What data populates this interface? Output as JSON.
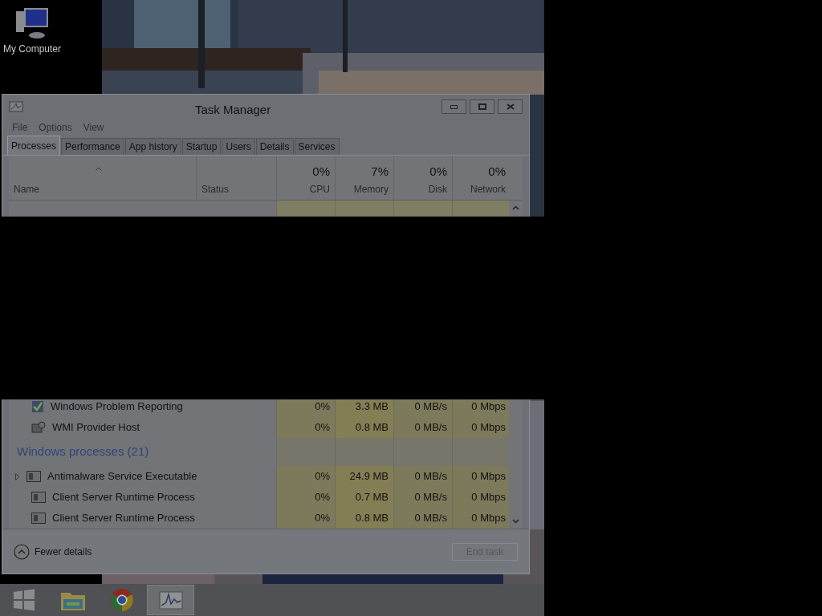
{
  "desktop_icons": [
    {
      "label": "My Computer"
    }
  ],
  "window": {
    "title": "Task Manager"
  },
  "menu": [
    "File",
    "Options",
    "View"
  ],
  "tabs": [
    {
      "label": "Processes",
      "selected": true
    },
    {
      "label": "Performance",
      "selected": false
    },
    {
      "label": "App history",
      "selected": false
    },
    {
      "label": "Startup",
      "selected": false
    },
    {
      "label": "Users",
      "selected": false
    },
    {
      "label": "Details",
      "selected": false
    },
    {
      "label": "Services",
      "selected": false
    }
  ],
  "columns": [
    {
      "label": "Name",
      "kind": "text"
    },
    {
      "label": "Status",
      "kind": "text"
    },
    {
      "label": "CPU",
      "kind": "metric",
      "total": "0%"
    },
    {
      "label": "Memory",
      "kind": "metric",
      "total": "7%"
    },
    {
      "label": "Disk",
      "kind": "metric",
      "total": "0%"
    },
    {
      "label": "Network",
      "kind": "metric",
      "total": "0%"
    }
  ],
  "rows": [
    {
      "kind": "process",
      "name": "Windows Problem Reporting",
      "expandable": false,
      "cpu": "0%",
      "memory": "3.3 MB",
      "disk": "0 MB/s",
      "network": "0 Mbps"
    },
    {
      "kind": "process",
      "name": "WMI Provider Host",
      "expandable": false,
      "cpu": "0%",
      "memory": "0.8 MB",
      "disk": "0 MB/s",
      "network": "0 Mbps"
    },
    {
      "kind": "group",
      "name": "Windows processes (21)"
    },
    {
      "kind": "process",
      "name": "Antimalware Service Executable",
      "expandable": true,
      "cpu": "0%",
      "memory": "24.9 MB",
      "disk": "0 MB/s",
      "network": "0 Mbps"
    },
    {
      "kind": "process",
      "name": "Client Server Runtime Process",
      "expandable": false,
      "cpu": "0%",
      "memory": "0.7 MB",
      "disk": "0 MB/s",
      "network": "0 Mbps"
    },
    {
      "kind": "process",
      "name": "Client Server Runtime Process",
      "expandable": false,
      "cpu": "0%",
      "memory": "0.8 MB",
      "disk": "0 MB/s",
      "network": "0 Mbps"
    }
  ],
  "footer": {
    "toggle": "Fewer details",
    "end_task": {
      "label": "End task",
      "disabled": true
    }
  },
  "taskbar": [
    {
      "kind": "start",
      "selected": false
    },
    {
      "kind": "folder",
      "selected": false
    },
    {
      "kind": "browser",
      "selected": false
    },
    {
      "kind": "task-manager",
      "selected": true
    }
  ]
}
